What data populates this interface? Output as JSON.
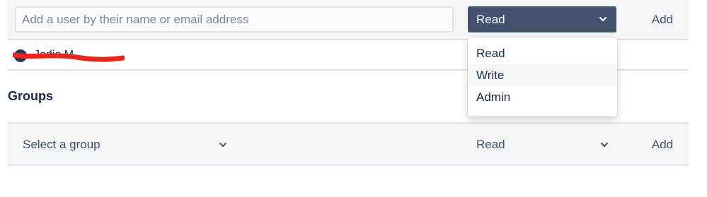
{
  "users": {
    "search_placeholder": "Add a user by their name or email address",
    "permission_selected": "Read",
    "add_label": "Add",
    "list": [
      {
        "name": "Jodie M"
      }
    ]
  },
  "groups": {
    "title": "Groups",
    "select_placeholder": "Select a group",
    "permission_selected": "Read",
    "add_label": "Add"
  },
  "permission_menu": {
    "options": [
      "Read",
      "Write",
      "Admin"
    ],
    "highlighted": "Write"
  },
  "colors": {
    "select_active_bg": "#42526e",
    "bar_bg": "#f4f5f7",
    "text_primary": "#172b4d",
    "redaction": "#e8261e"
  },
  "icons": {
    "dropdown": "chevron-down-icon"
  }
}
